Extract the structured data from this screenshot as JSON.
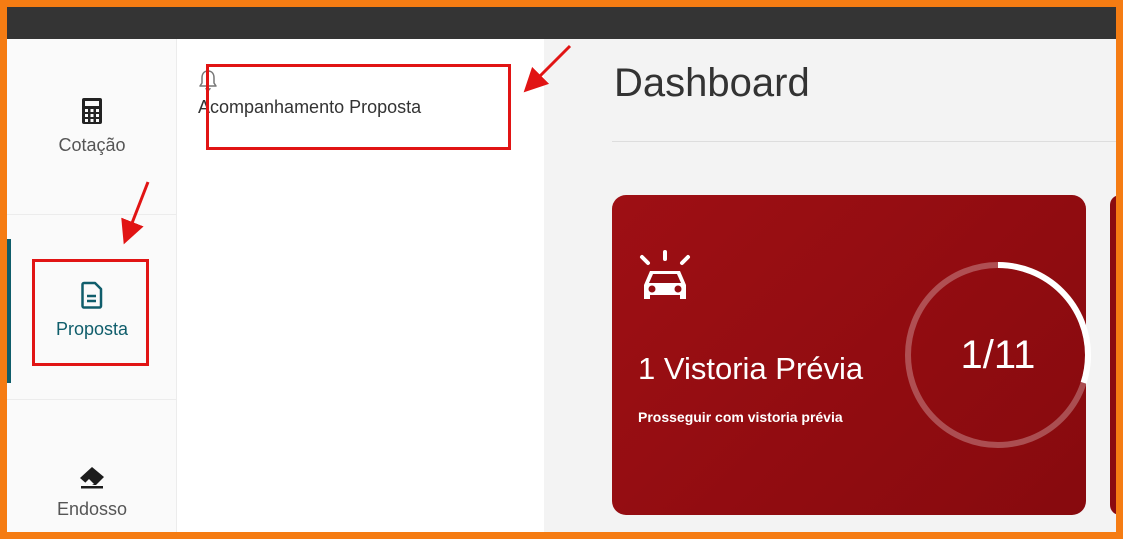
{
  "sidebar": {
    "items": [
      {
        "label": "Cotação",
        "icon": "calculator-icon"
      },
      {
        "label": "Proposta",
        "icon": "document-icon",
        "active": true
      },
      {
        "label": "Endosso",
        "icon": "eraser-icon"
      }
    ]
  },
  "submenu": {
    "items": [
      {
        "label": "Acompanhamento Proposta",
        "icon": "bell-icon"
      }
    ]
  },
  "main": {
    "title": "Dashboard",
    "cards": [
      {
        "icon": "car-alarm-icon",
        "title": "1 Vistoria Prévia",
        "subtitle": "Prosseguir com vistoria prévia",
        "counter": "1/11",
        "progress": 0.09
      }
    ]
  },
  "colors": {
    "frame": "#f57c13",
    "topbar": "#343434",
    "accent": "#0f5d6b",
    "card": "#9e0f14",
    "annotation": "#e11414"
  }
}
